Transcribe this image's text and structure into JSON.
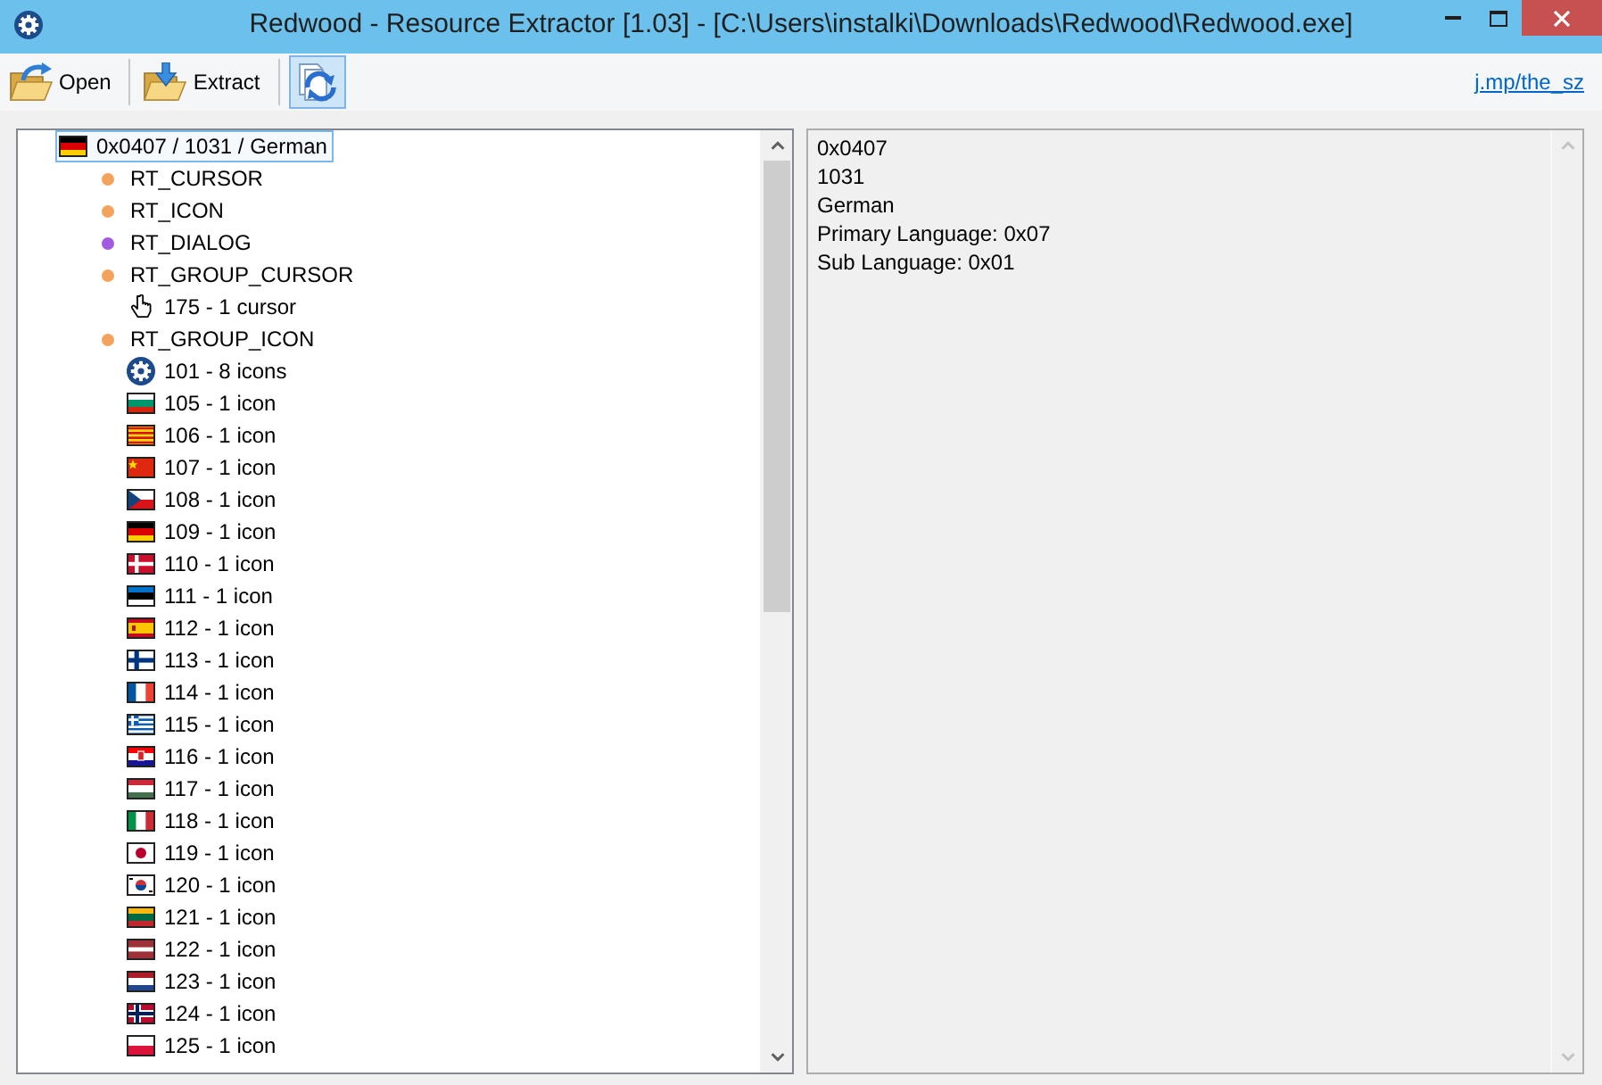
{
  "window": {
    "title": "Redwood - Resource Extractor [1.03] - [C:\\Users\\instalki\\Downloads\\Redwood\\Redwood.exe]"
  },
  "toolbar": {
    "buttons": [
      {
        "label": "Open",
        "pressed": false
      },
      {
        "label": "Extract",
        "pressed": false
      },
      {
        "pressed": true
      }
    ],
    "link": "j.mp/the_sz"
  },
  "tree": [
    {
      "label": "0x0407 / 1031 / German",
      "kind": "language",
      "selected": true,
      "children": [
        {
          "label": "RT_CURSOR",
          "kind": "type",
          "color": "#f4a35c",
          "selected": false
        },
        {
          "label": "RT_ICON",
          "kind": "type",
          "color": "#f4a35c",
          "selected": false
        },
        {
          "label": "RT_DIALOG",
          "kind": "type",
          "color": "#a45ae0",
          "selected": false
        },
        {
          "label": "RT_GROUP_CURSOR",
          "kind": "type",
          "color": "#f4a35c",
          "selected": false,
          "children": [
            {
              "label": "175 - 1 cursor",
              "kind": "cursor",
              "selected": false
            }
          ]
        },
        {
          "label": "RT_GROUP_ICON",
          "kind": "type",
          "color": "#f4a35c",
          "selected": false,
          "children": [
            {
              "label": "101 - 8 icons",
              "kind": "app",
              "selected": false
            },
            {
              "label": "105 - 1 icon",
              "kind": "flag",
              "selected": false
            },
            {
              "label": "106 - 1 icon",
              "kind": "flag",
              "selected": false
            },
            {
              "label": "107 - 1 icon",
              "kind": "flag",
              "selected": false
            },
            {
              "label": "108 - 1 icon",
              "kind": "flag",
              "selected": false
            },
            {
              "label": "109 - 1 icon",
              "kind": "flag",
              "selected": false
            },
            {
              "label": "110 - 1 icon",
              "kind": "flag",
              "selected": false
            },
            {
              "label": "111 - 1 icon",
              "kind": "flag",
              "selected": false
            },
            {
              "label": "112 - 1 icon",
              "kind": "flag",
              "selected": false
            },
            {
              "label": "113 - 1 icon",
              "kind": "flag",
              "selected": false
            },
            {
              "label": "114 - 1 icon",
              "kind": "flag",
              "selected": false
            },
            {
              "label": "115 - 1 icon",
              "kind": "flag",
              "selected": false
            },
            {
              "label": "116 - 1 icon",
              "kind": "flag",
              "selected": false
            },
            {
              "label": "117 - 1 icon",
              "kind": "flag",
              "selected": false
            },
            {
              "label": "118 - 1 icon",
              "kind": "flag",
              "selected": false
            },
            {
              "label": "119 - 1 icon",
              "kind": "flag",
              "selected": false
            },
            {
              "label": "120 - 1 icon",
              "kind": "flag",
              "selected": false
            },
            {
              "label": "121 - 1 icon",
              "kind": "flag",
              "selected": false
            },
            {
              "label": "122 - 1 icon",
              "kind": "flag",
              "selected": false
            },
            {
              "label": "123 - 1 icon",
              "kind": "flag",
              "selected": false
            },
            {
              "label": "124 - 1 icon",
              "kind": "flag",
              "selected": false
            },
            {
              "label": "125 - 1 icon",
              "kind": "flag",
              "selected": false
            }
          ]
        }
      ]
    }
  ],
  "details": {
    "lines": [
      "0x0407",
      "1031",
      "German",
      "Primary Language: 0x07",
      "Sub Language: 0x01"
    ]
  }
}
